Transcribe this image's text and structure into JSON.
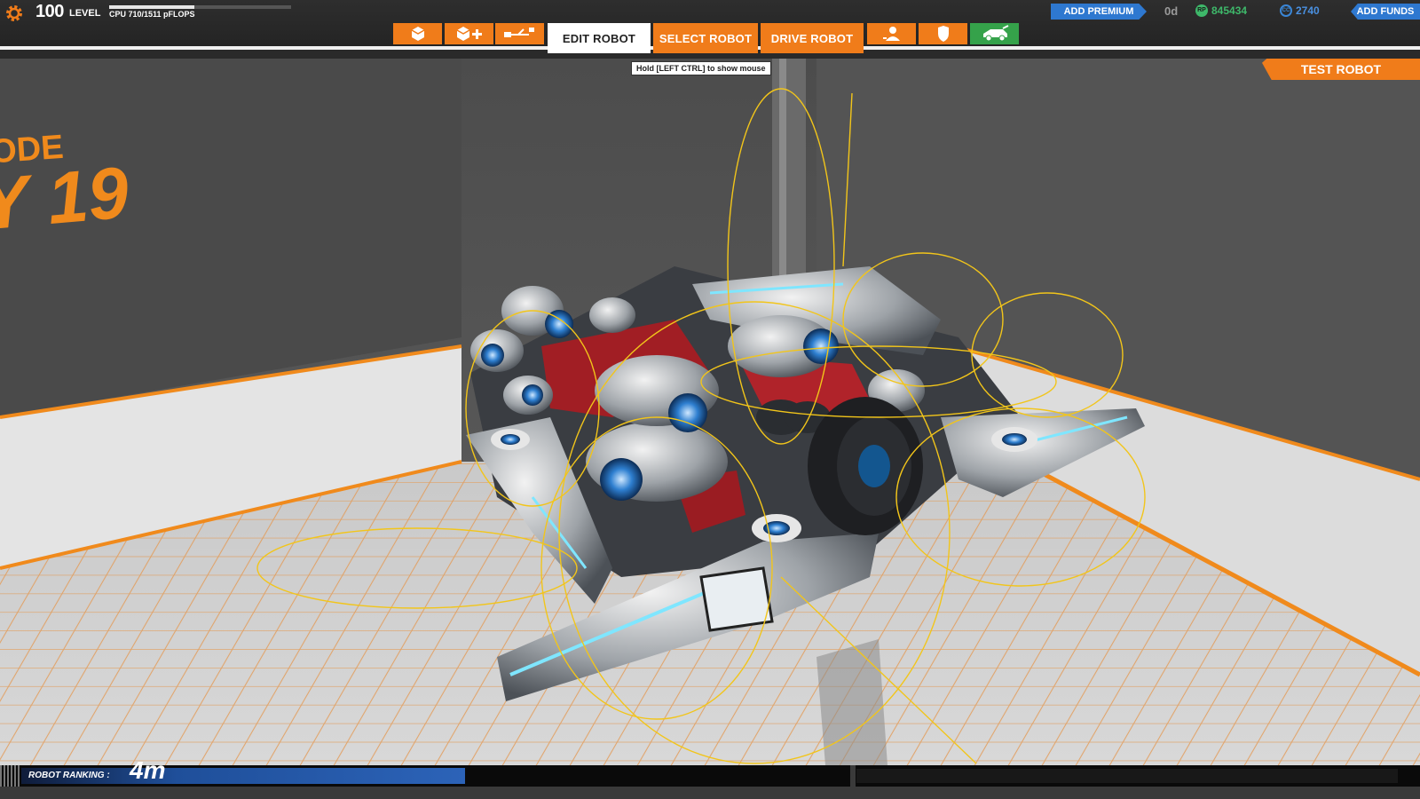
{
  "header": {
    "level_number": "100",
    "level_label": "LEVEL",
    "cpu_text": "CPU 710/1511 pFLOPS",
    "cpu_used": 710,
    "cpu_max": 1511
  },
  "toolbar": {
    "icons": [
      "cube-icon",
      "cube-plus-icon",
      "connect-icon",
      "user-icon",
      "shield-icon",
      "vehicle-icon"
    ],
    "tabs": {
      "edit": "EDIT ROBOT",
      "select": "SELECT ROBOT",
      "drive": "DRIVE ROBOT"
    }
  },
  "currency": {
    "add_premium": "ADD PREMIUM",
    "premium_days": "0d",
    "rp_label": "RP",
    "rp_value": "845434",
    "cc_label": "CC",
    "cc_value": "2740",
    "add_funds": "ADD FUNDS"
  },
  "hint": "Hold [LEFT CTRL] to show mouse",
  "test_robot": "TEST ROBOT",
  "wall_text": {
    "line1": "ODE",
    "line2": "Y 19"
  },
  "ranking": {
    "label": "ROBOT RANKING :",
    "value": "4m"
  },
  "colors": {
    "accent_orange": "#f07c1a",
    "premium_blue": "#2e78d0",
    "rp_green": "#3eb86a",
    "cc_blue": "#4a90e0"
  }
}
